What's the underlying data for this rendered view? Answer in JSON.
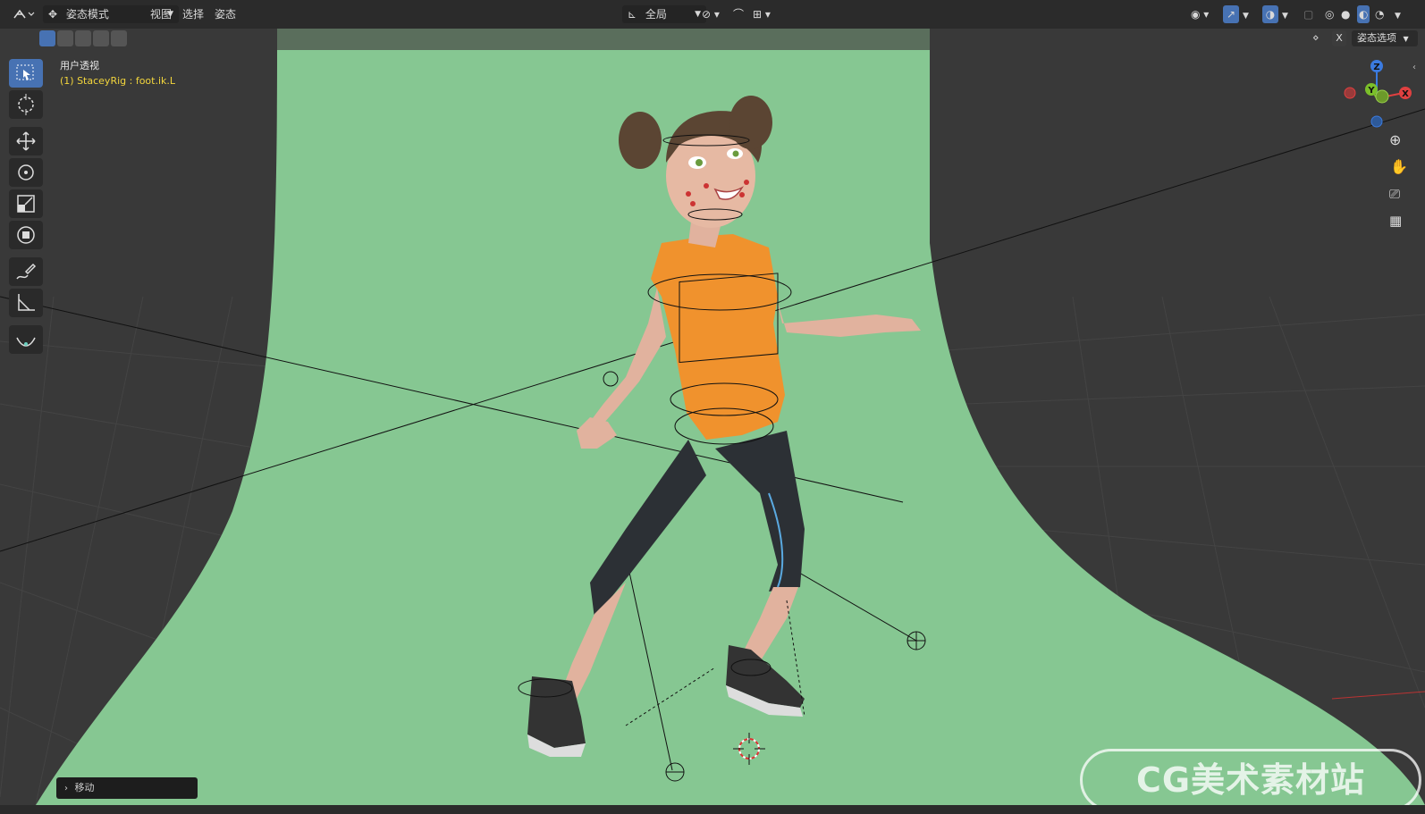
{
  "header": {
    "mode_label": "姿态模式",
    "menu": [
      "视图",
      "选择",
      "姿态"
    ],
    "orientation_label": "全局",
    "pose_options_label": "姿态选项",
    "x_label": "X"
  },
  "viewport": {
    "view_name": "用户透视",
    "active_object": "(1) StaceyRig : foot.ik.L",
    "backdrop_color": "#86c792",
    "grid_color": "#3a3a3a"
  },
  "gizmo": {
    "z": "Z",
    "y": "Y",
    "x": "X"
  },
  "operator_panel": {
    "label": "移动"
  },
  "watermark": {
    "text": "CG美术素材站"
  },
  "tools": [
    "select-box-icon",
    "cursor-icon",
    "move-icon",
    "rotate-icon",
    "scale-icon",
    "transform-icon",
    "annotate-icon",
    "measure-icon",
    "relax-pose-icon"
  ]
}
